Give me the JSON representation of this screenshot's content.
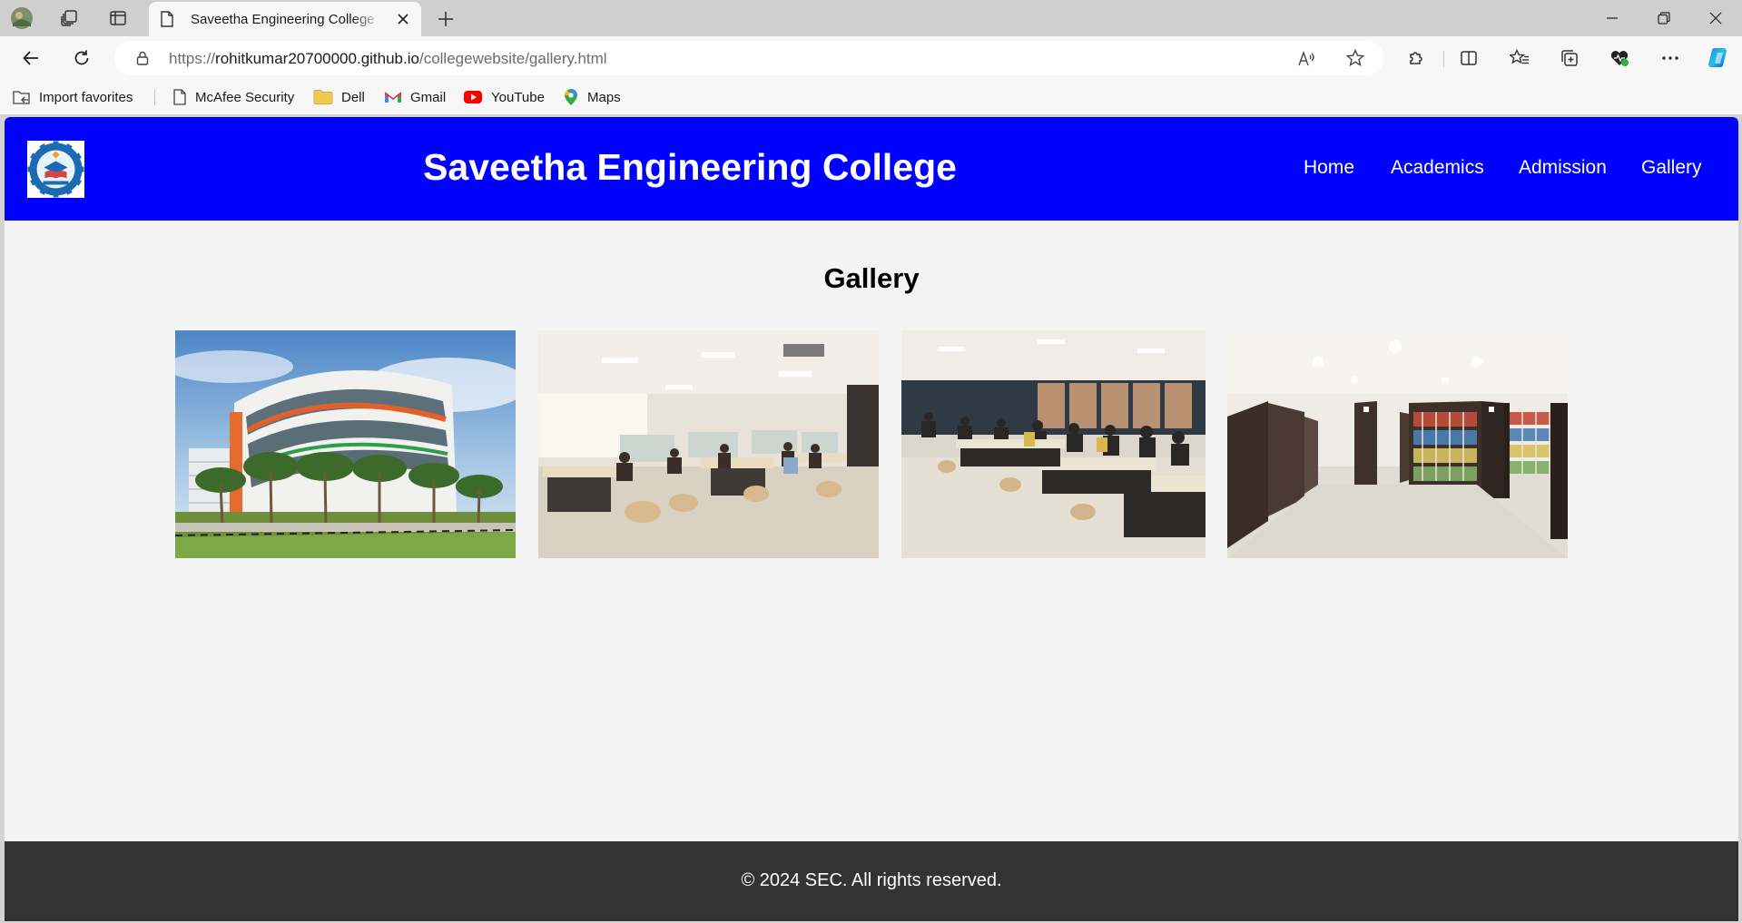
{
  "browser": {
    "tab_title": "Saveetha Engineering College - Gallery",
    "url_scheme": "https://",
    "url_host": "rohitkumar20700000.github.io",
    "url_path": "/collegewebsite/gallery.html",
    "bookmarks": [
      {
        "label": "Import favorites",
        "icon": "import-favorites-icon"
      },
      {
        "label": "McAfee Security",
        "icon": "page-icon"
      },
      {
        "label": "Dell",
        "icon": "folder-icon"
      },
      {
        "label": "Gmail",
        "icon": "gmail-icon"
      },
      {
        "label": "YouTube",
        "icon": "youtube-icon"
      },
      {
        "label": "Maps",
        "icon": "maps-icon"
      }
    ]
  },
  "header": {
    "title": "Saveetha Engineering College",
    "logo_icon": "college-emblem-icon",
    "nav": [
      "Home",
      "Academics",
      "Admission",
      "Gallery"
    ],
    "background_color": "#0000ff"
  },
  "gallery": {
    "heading": "Gallery",
    "images": [
      {
        "subject": "college-building-photo"
      },
      {
        "subject": "reading-hall-photo"
      },
      {
        "subject": "study-hall-photo"
      },
      {
        "subject": "library-bookshelves-photo"
      }
    ]
  },
  "footer": {
    "text": "© 2024 SEC. All rights reserved.",
    "background_color": "#333333"
  }
}
